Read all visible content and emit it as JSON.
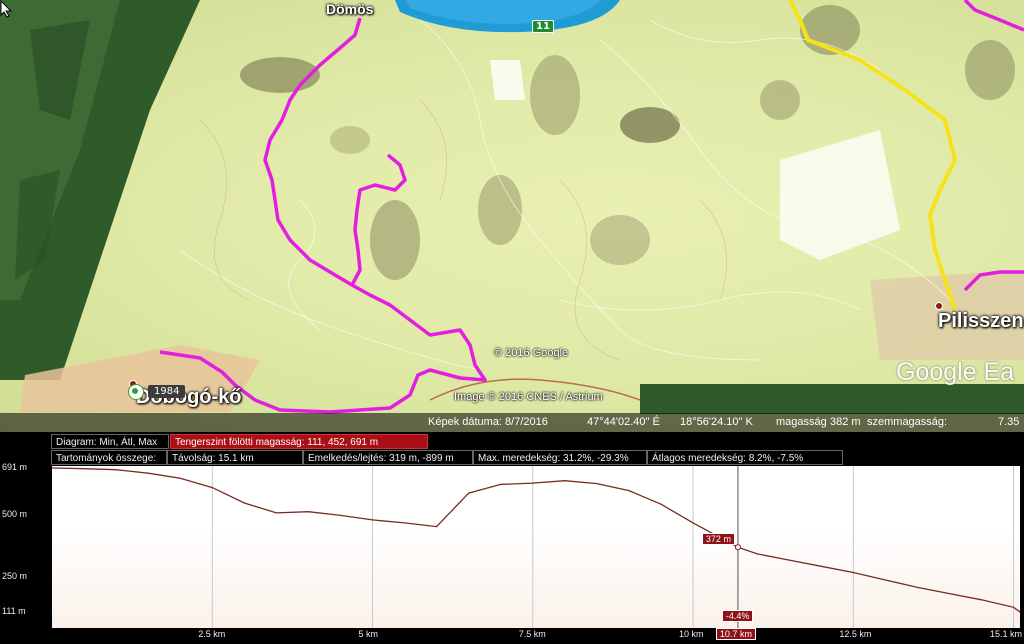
{
  "map": {
    "places": {
      "domos": "Dömös",
      "dobogoko": "Dobogó-kő",
      "pilisszentlaszlo": "Pilisszen"
    },
    "badge": "1984",
    "road_number": "11",
    "copyright_google": "© 2016 Google",
    "copyright_image": "Image © 2016 CNES / Astrium",
    "logo": "Google Ea",
    "icons": [
      "cursor-icon",
      "viewer-icon"
    ]
  },
  "status": {
    "image_date": "Képek dátuma: 8/7/2016",
    "lat": "47°44'02.40\" É",
    "lon": "18°56'24.10\" K",
    "elev_label": "magasság",
    "elev_value": "382 m",
    "eye_label": "szemmagasság:",
    "eye_value": "7.35"
  },
  "profile": {
    "row1": {
      "diagram": "Diagram: Min, Átl, Max",
      "altitude": "Tengerszint fölötti magasság: 111, 452, 691 m"
    },
    "row2": {
      "ranges": "Tartományok összege:",
      "distance": "Távolság: 15.1 km",
      "gain_loss": "Emelkedés/lejtés: 319 m, -899 m",
      "max_slope": "Max. meredekség: 31.2%, -29.3%",
      "avg_slope": "Átlagos meredekség: 8.2%, -7.5%"
    },
    "cursor": {
      "elevation_label": "372 m",
      "slope_label": "-4.4%",
      "distance_label": "10.7 km",
      "distance_km": 10.7,
      "elevation_m": 372
    }
  },
  "chart_data": {
    "type": "area",
    "x": [
      0,
      0.5,
      1,
      1.5,
      2,
      2.5,
      3,
      3.5,
      4,
      4.5,
      5,
      5.5,
      6,
      6.5,
      7,
      7.5,
      8,
      8.5,
      9,
      9.5,
      10,
      10.5,
      10.7,
      11,
      11.5,
      12,
      12.5,
      13,
      13.5,
      14,
      14.5,
      15,
      15.1
    ],
    "series": [
      {
        "values": [
          691,
          688,
          684,
          670,
          650,
          612,
          550,
          510,
          515,
          500,
          482,
          470,
          455,
          590,
          625,
          630,
          640,
          628,
          600,
          545,
          470,
          400,
          372,
          345,
          320,
          295,
          270,
          240,
          210,
          185,
          160,
          130,
          111
        ]
      }
    ],
    "yticks": [
      691,
      500,
      250,
      111
    ],
    "ytick_labels": [
      "691 m",
      "500 m",
      "250 m",
      "111 m"
    ],
    "xticks": [
      2.5,
      5,
      7.5,
      10,
      12.5,
      15
    ],
    "xtick_labels": [
      "2.5 km",
      "5 km",
      "7.5 km",
      "10 km",
      "12.5 km",
      "15.1 km"
    ],
    "ylim": [
      111,
      691
    ],
    "xlim": [
      0,
      15.1
    ],
    "grid": true
  }
}
